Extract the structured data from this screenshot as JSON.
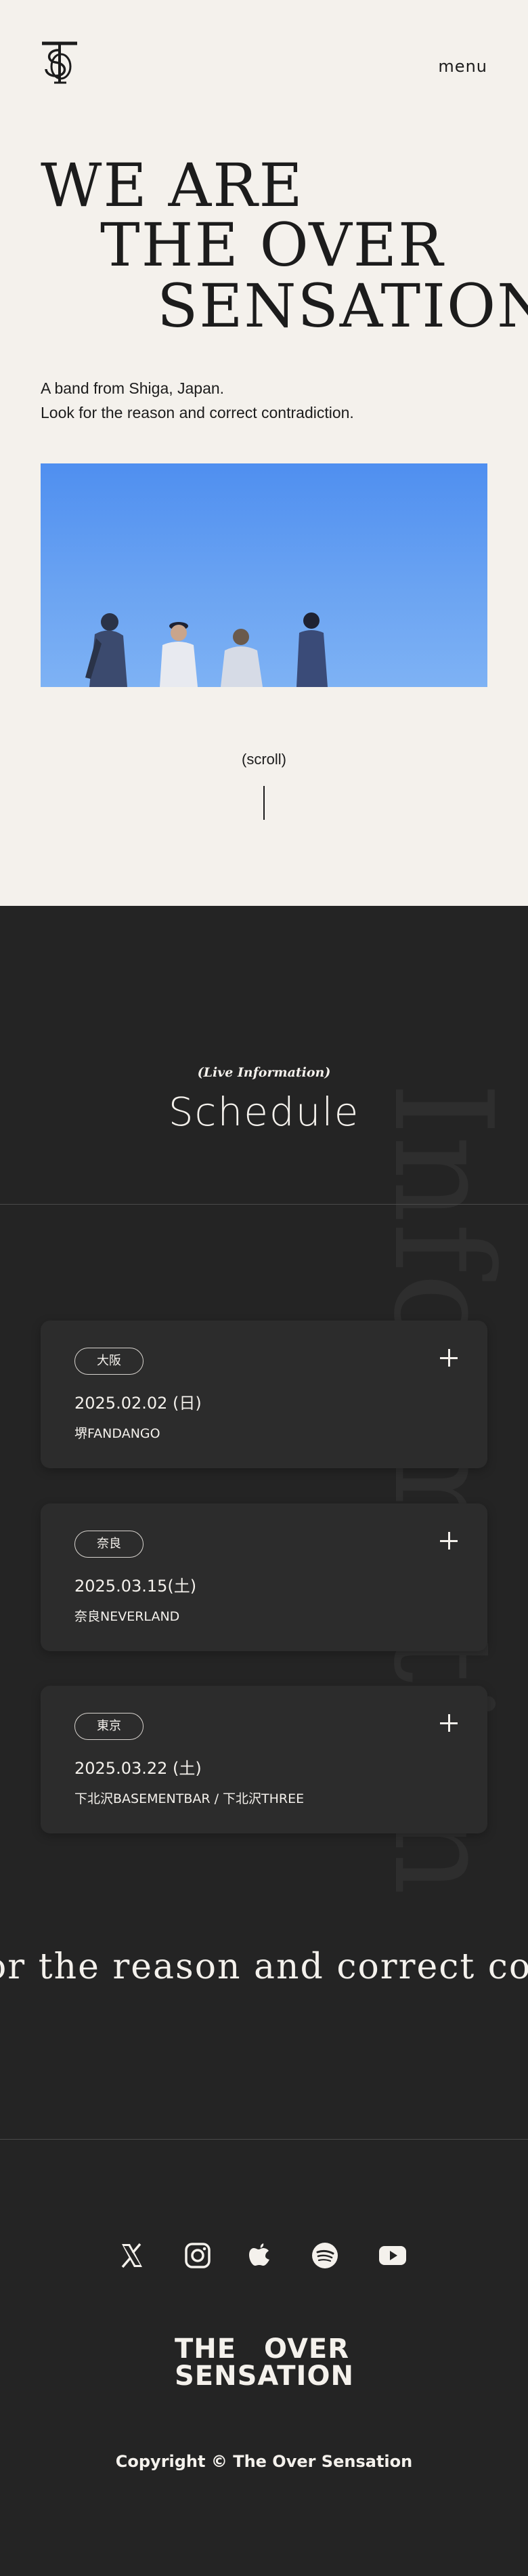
{
  "header": {
    "menu_label": "menu",
    "logo_icon": "tos-monogram-icon"
  },
  "hero": {
    "headline_line1": "WE ARE",
    "headline_line2": "THE OVER",
    "headline_line3": "SENSATION",
    "tagline_line1": "A band from Shiga, Japan.",
    "tagline_line2": "Look for the reason and correct contradiction.",
    "scroll_label": "(scroll)",
    "photo_colors": {
      "sky_top": "#4f8ff0",
      "sky_bottom": "#7eb2f4"
    }
  },
  "schedule": {
    "vertical_word": "Information",
    "subhead": "(Live Information)",
    "title": "Schedule",
    "events": [
      {
        "area": "大阪",
        "date": "2025.02.02 (日)",
        "venue": "堺FANDANGO"
      },
      {
        "area": "奈良",
        "date": "2025.03.15(土)",
        "venue": "奈良NEVERLAND"
      },
      {
        "area": "東京",
        "date": "2025.03.22 (土)",
        "venue": "下北沢BASEMENTBAR / 下北沢THREE"
      }
    ],
    "marquee_text": "or the reason and correct contr"
  },
  "footer": {
    "socials": [
      {
        "name": "x-icon"
      },
      {
        "name": "instagram-icon"
      },
      {
        "name": "apple-music-icon"
      },
      {
        "name": "spotify-icon"
      },
      {
        "name": "youtube-icon"
      }
    ],
    "logo_line1": "THE OVER",
    "logo_line2": "SENSATION",
    "copyright": "Copyright © The Over Sensation"
  },
  "colors": {
    "light_bg": "#f4f1ec",
    "dark_bg": "#242424",
    "card_bg": "#2c2c2c",
    "text_dark": "#1c1c1c",
    "text_light": "#f4f1ec"
  }
}
